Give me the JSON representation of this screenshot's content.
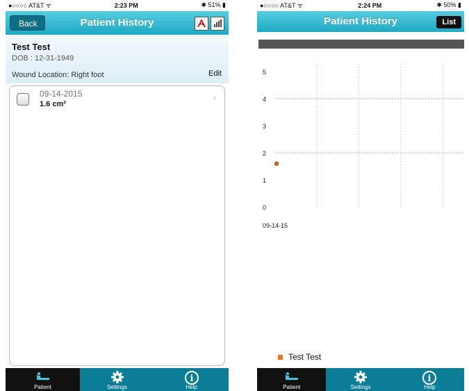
{
  "left": {
    "status": {
      "carrier": "●○○○○ AT&T ᯤ",
      "time": "2:23 PM",
      "battery": "51%"
    },
    "nav": {
      "title": "Patient History",
      "back": "Back",
      "icons": [
        "pdf-icon",
        "chart-icon"
      ]
    },
    "patient": {
      "name": "Test Test",
      "dob": "DOB : 12-31-1949",
      "location": "Wound Location: Right foot",
      "edit": "Edit"
    },
    "entries": [
      {
        "date": "09-14-2015",
        "area": "1.6 cm²"
      }
    ],
    "tabs": [
      {
        "label": "Patient",
        "icon": "patient-bed-icon",
        "active": true
      },
      {
        "label": "Settings",
        "icon": "gear-icon",
        "active": false
      },
      {
        "label": "Help",
        "icon": "info-icon",
        "active": false
      }
    ]
  },
  "right": {
    "status": {
      "carrier": "●○○○○ AT&T ᯤ",
      "time": "2:24 PM",
      "battery": "50%"
    },
    "nav": {
      "title": "Patient History",
      "list": "List"
    },
    "tabs": [
      {
        "label": "Patient",
        "icon": "patient-bed-icon",
        "active": true
      },
      {
        "label": "Settings",
        "icon": "gear-icon",
        "active": false
      },
      {
        "label": "Help",
        "icon": "info-icon",
        "active": false
      }
    ]
  },
  "chart_data": {
    "type": "scatter",
    "x": [
      "09-14-15"
    ],
    "series": [
      {
        "name": "Test Test",
        "values": [
          1.6
        ],
        "color": "#f07020"
      }
    ],
    "ylim": [
      0,
      5
    ],
    "yticks": [
      "0",
      "1",
      "2",
      "3",
      "4",
      "5"
    ],
    "xticks": [
      "09-14-15"
    ],
    "grid": true,
    "legend": "bottom"
  }
}
